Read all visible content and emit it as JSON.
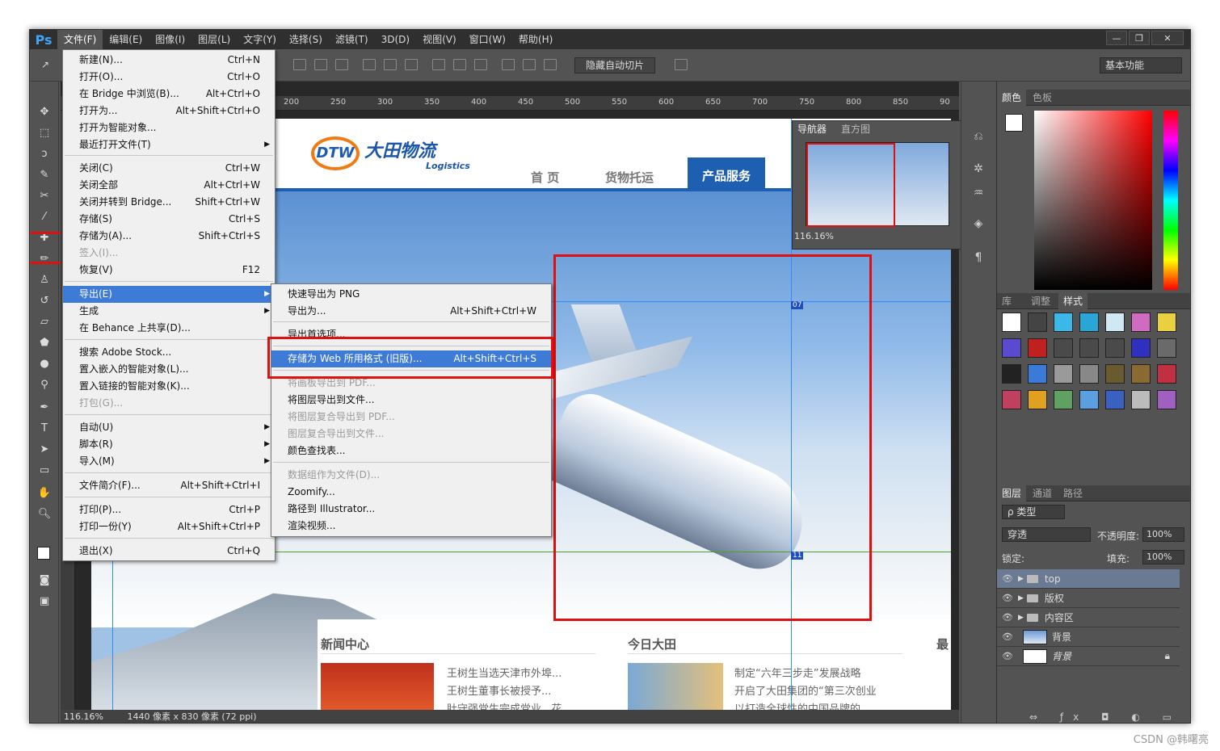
{
  "menubar": {
    "logo": "Ps",
    "items": [
      "文件(F)",
      "编辑(E)",
      "图像(I)",
      "图层(L)",
      "文字(Y)",
      "选择(S)",
      "滤镜(T)",
      "3D(D)",
      "视图(V)",
      "窗口(W)",
      "帮助(H)"
    ]
  },
  "window_controls": {
    "minimize": "—",
    "restore": "❐",
    "close": "✕"
  },
  "options": {
    "hide_slices": "隐藏自动切片",
    "workspace": "基本功能"
  },
  "ruler": {
    "ticks": [
      "200",
      "250",
      "300",
      "350",
      "400",
      "450",
      "500",
      "550",
      "600",
      "650",
      "700",
      "750",
      "800",
      "850",
      "90"
    ]
  },
  "file_menu": [
    {
      "label": "新建(N)...",
      "shortcut": "Ctrl+N"
    },
    {
      "label": "打开(O)...",
      "shortcut": "Ctrl+O"
    },
    {
      "label": "在 Bridge 中浏览(B)...",
      "shortcut": "Alt+Ctrl+O"
    },
    {
      "label": "打开为...",
      "shortcut": "Alt+Shift+Ctrl+O"
    },
    {
      "label": "打开为智能对象...",
      "shortcut": ""
    },
    {
      "label": "最近打开文件(T)",
      "shortcut": "",
      "submenu": true
    },
    {
      "label": "关闭(C)",
      "shortcut": "Ctrl+W"
    },
    {
      "label": "关闭全部",
      "shortcut": "Alt+Ctrl+W"
    },
    {
      "label": "关闭并转到 Bridge...",
      "shortcut": "Shift+Ctrl+W"
    },
    {
      "label": "存储(S)",
      "shortcut": "Ctrl+S"
    },
    {
      "label": "存储为(A)...",
      "shortcut": "Shift+Ctrl+S"
    },
    {
      "label": "签入(I)...",
      "shortcut": "",
      "disabled": true
    },
    {
      "label": "恢复(V)",
      "shortcut": "F12"
    },
    {
      "label": "导出(E)",
      "shortcut": "",
      "submenu": true,
      "highlighted": true
    },
    {
      "label": "生成",
      "shortcut": "",
      "submenu": true
    },
    {
      "label": "在 Behance 上共享(D)...",
      "shortcut": ""
    },
    {
      "label": "搜索 Adobe Stock...",
      "shortcut": ""
    },
    {
      "label": "置入嵌入的智能对象(L)...",
      "shortcut": ""
    },
    {
      "label": "置入链接的智能对象(K)...",
      "shortcut": ""
    },
    {
      "label": "打包(G)...",
      "shortcut": "",
      "disabled": true
    },
    {
      "label": "自动(U)",
      "shortcut": "",
      "submenu": true
    },
    {
      "label": "脚本(R)",
      "shortcut": "",
      "submenu": true
    },
    {
      "label": "导入(M)",
      "shortcut": "",
      "submenu": true
    },
    {
      "label": "文件简介(F)...",
      "shortcut": "Alt+Shift+Ctrl+I"
    },
    {
      "label": "打印(P)...",
      "shortcut": "Ctrl+P"
    },
    {
      "label": "打印一份(Y)",
      "shortcut": "Alt+Shift+Ctrl+P"
    },
    {
      "label": "退出(X)",
      "shortcut": "Ctrl+Q"
    }
  ],
  "export_menu": [
    {
      "label": "快速导出为 PNG",
      "shortcut": ""
    },
    {
      "label": "导出为...",
      "shortcut": "Alt+Shift+Ctrl+W"
    },
    {
      "label": "导出首选项...",
      "shortcut": ""
    },
    {
      "label": "存储为 Web 所用格式 (旧版)...",
      "shortcut": "Alt+Shift+Ctrl+S",
      "highlighted": true
    },
    {
      "label": "将画板导出到 PDF...",
      "shortcut": "",
      "disabled": true
    },
    {
      "label": "将图层导出到文件...",
      "shortcut": ""
    },
    {
      "label": "将图层复合导出到 PDF...",
      "shortcut": "",
      "disabled": true
    },
    {
      "label": "图层复合导出到文件...",
      "shortcut": "",
      "disabled": true
    },
    {
      "label": "颜色查找表...",
      "shortcut": ""
    },
    {
      "label": "数据组作为文件(D)...",
      "shortcut": "",
      "disabled": true
    },
    {
      "label": "Zoomify...",
      "shortcut": ""
    },
    {
      "label": "路径到 Illustrator...",
      "shortcut": ""
    },
    {
      "label": "渲染视频...",
      "shortcut": ""
    }
  ],
  "site": {
    "logo_mark": "DTW",
    "logo_text": "大田物流",
    "logo_sub": "Logistics",
    "nav": [
      "首 页",
      "货物托运",
      "产品服务"
    ],
    "news_title": "新闻中心",
    "news_items": [
      "王树生当选天津市外埠...",
      "王树生董事长被授予...",
      "肚守强党生完成党业...花..."
    ],
    "today_title": "今日大田",
    "today_items": [
      "制定“六年三步走”发展战略",
      "开启了大田集团的“第三次创业",
      "以打造全球性的中国品牌的"
    ],
    "more_title": "最",
    "slice_tag_1": "07",
    "slice_tag_2": "11"
  },
  "navigator": {
    "tabs": [
      "导航器",
      "直方图"
    ],
    "zoom": "116.16%"
  },
  "color_panel": {
    "tabs": [
      "颜色",
      "色板"
    ]
  },
  "styles_panel": {
    "tabs": [
      "库",
      "调整",
      "样式"
    ]
  },
  "layers_panel": {
    "tabs": [
      "图层",
      "通道",
      "路径"
    ],
    "filter": "ρ 类型",
    "blend": "穿透",
    "opacity_label": "不透明度:",
    "opacity": "100%",
    "lock_label": "锁定:",
    "fill_label": "填充:",
    "fill": "100%",
    "layers": [
      {
        "name": "top",
        "type": "folder",
        "selected": true
      },
      {
        "name": "版权",
        "type": "folder"
      },
      {
        "name": "内容区",
        "type": "folder"
      },
      {
        "name": "背景",
        "type": "image"
      },
      {
        "name": "背景",
        "type": "white",
        "locked": true
      }
    ]
  },
  "status": {
    "zoom": "116.16%",
    "info": "1440 像素 x 830 像素 (72 ppi)"
  },
  "credit": "CSDN @韩曙亮",
  "colors": {
    "accent": "#3d7bd6",
    "highlight_box": "#e01010",
    "site_blue": "#1e5fb1"
  }
}
